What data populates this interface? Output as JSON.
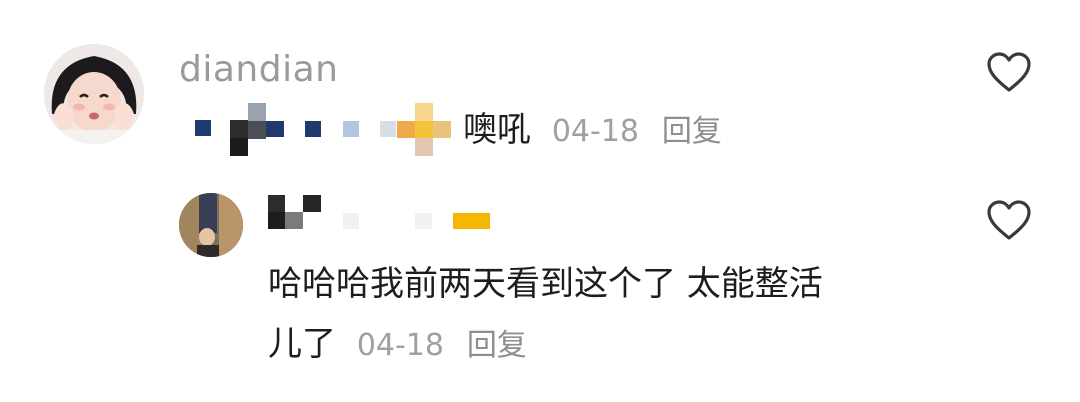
{
  "comment": {
    "username": "diandian",
    "text": "噢吼",
    "date": "04-18",
    "reply_label": "回复"
  },
  "reply": {
    "text_line1": "哈哈哈我前两天看到这个了 太能整活",
    "text_line2": "儿了",
    "date": "04-18",
    "reply_label": "回复"
  },
  "icons": {
    "like": "heart-outline-icon"
  },
  "colors": {
    "username": "#9a9a9a",
    "meta": "#a0a0a0",
    "emoji_yellow": "#f5b800"
  }
}
